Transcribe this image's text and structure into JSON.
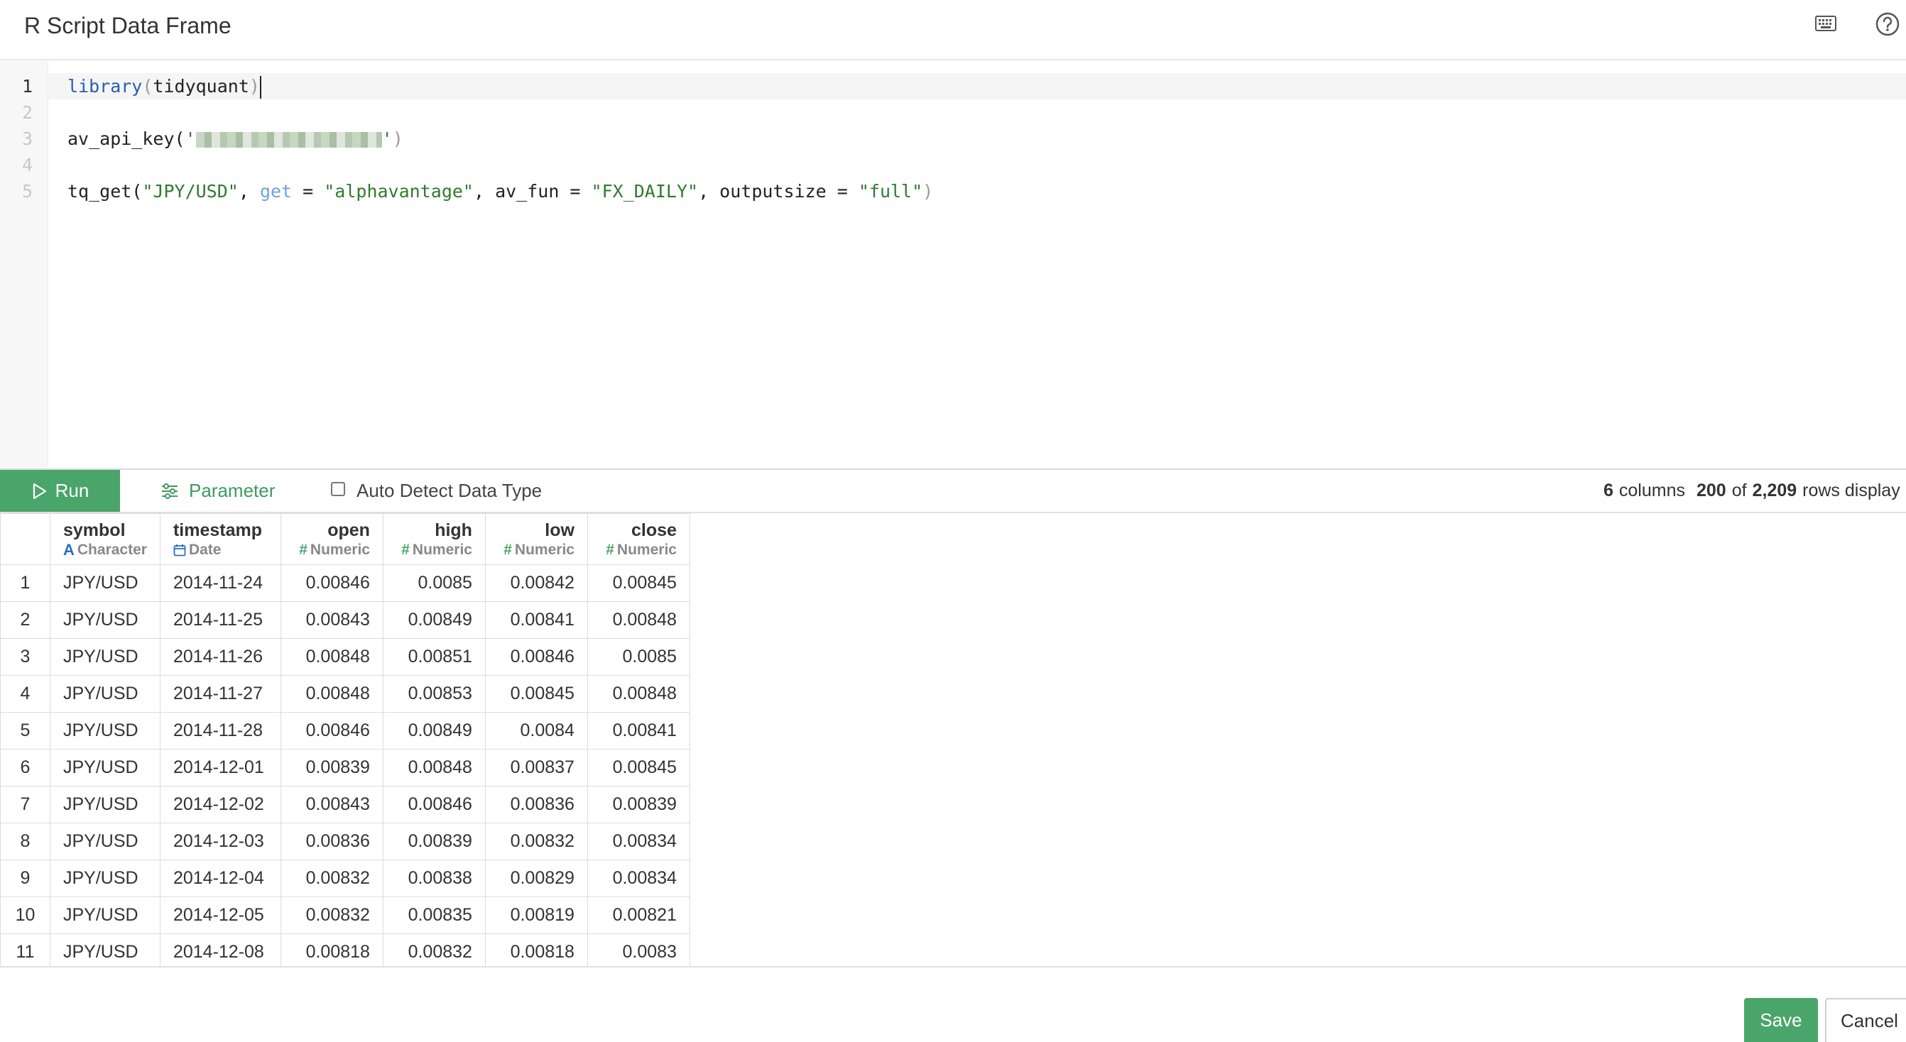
{
  "header": {
    "title": "R Script Data Frame",
    "keyboard_icon": "keyboard-icon",
    "help_icon": "help-icon"
  },
  "editor": {
    "line_numbers": [
      "1",
      "2",
      "3",
      "4",
      "5"
    ],
    "line1": {
      "fn": "library",
      "open": "(",
      "arg": "tidyquant",
      "close": ")"
    },
    "line3": {
      "fn": "av_api_key(",
      "quote_open": "'",
      "quote_close": "'",
      "close": ")"
    },
    "line5": {
      "fn": "tq_get(",
      "s1": "\"JPY/USD\"",
      "sep1": ", ",
      "arg_get": "get",
      "eq1": " = ",
      "s2": "\"alphavantage\"",
      "sep2": ", av_fun = ",
      "s3": "\"FX_DAILY\"",
      "sep3": ", outputsize = ",
      "s4": "\"full\"",
      "close": ")"
    }
  },
  "toolbar": {
    "run_label": "Run",
    "parameter_label": "Parameter",
    "auto_detect_label": "Auto Detect Data Type",
    "auto_detect_checked": false,
    "columns_count": "6",
    "columns_label": "columns",
    "rows_shown": "200",
    "rows_of": "of",
    "rows_total": "2,209",
    "rows_label": "rows display"
  },
  "table": {
    "columns": [
      {
        "name": "symbol",
        "type": "Character",
        "type_icon": "A"
      },
      {
        "name": "timestamp",
        "type": "Date",
        "type_icon": "calendar-icon"
      },
      {
        "name": "open",
        "type": "Numeric",
        "type_icon": "#"
      },
      {
        "name": "high",
        "type": "Numeric",
        "type_icon": "#"
      },
      {
        "name": "low",
        "type": "Numeric",
        "type_icon": "#"
      },
      {
        "name": "close",
        "type": "Numeric",
        "type_icon": "#"
      }
    ],
    "rows": [
      [
        "1",
        "JPY/USD",
        "2014-11-24",
        "0.00846",
        "0.0085",
        "0.00842",
        "0.00845"
      ],
      [
        "2",
        "JPY/USD",
        "2014-11-25",
        "0.00843",
        "0.00849",
        "0.00841",
        "0.00848"
      ],
      [
        "3",
        "JPY/USD",
        "2014-11-26",
        "0.00848",
        "0.00851",
        "0.00846",
        "0.0085"
      ],
      [
        "4",
        "JPY/USD",
        "2014-11-27",
        "0.00848",
        "0.00853",
        "0.00845",
        "0.00848"
      ],
      [
        "5",
        "JPY/USD",
        "2014-11-28",
        "0.00846",
        "0.00849",
        "0.0084",
        "0.00841"
      ],
      [
        "6",
        "JPY/USD",
        "2014-12-01",
        "0.00839",
        "0.00848",
        "0.00837",
        "0.00845"
      ],
      [
        "7",
        "JPY/USD",
        "2014-12-02",
        "0.00843",
        "0.00846",
        "0.00836",
        "0.00839"
      ],
      [
        "8",
        "JPY/USD",
        "2014-12-03",
        "0.00836",
        "0.00839",
        "0.00832",
        "0.00834"
      ],
      [
        "9",
        "JPY/USD",
        "2014-12-04",
        "0.00832",
        "0.00838",
        "0.00829",
        "0.00834"
      ],
      [
        "10",
        "JPY/USD",
        "2014-12-05",
        "0.00832",
        "0.00835",
        "0.00819",
        "0.00821"
      ],
      [
        "11",
        "JPY/USD",
        "2014-12-08",
        "0.00818",
        "0.00832",
        "0.00818",
        "0.0083"
      ]
    ]
  },
  "footer": {
    "save_label": "Save",
    "cancel_label": "Cancel"
  },
  "colors": {
    "accent_green": "#4aa56a",
    "keyword_blue": "#2a5db0",
    "string_green": "#2f7a2f"
  }
}
